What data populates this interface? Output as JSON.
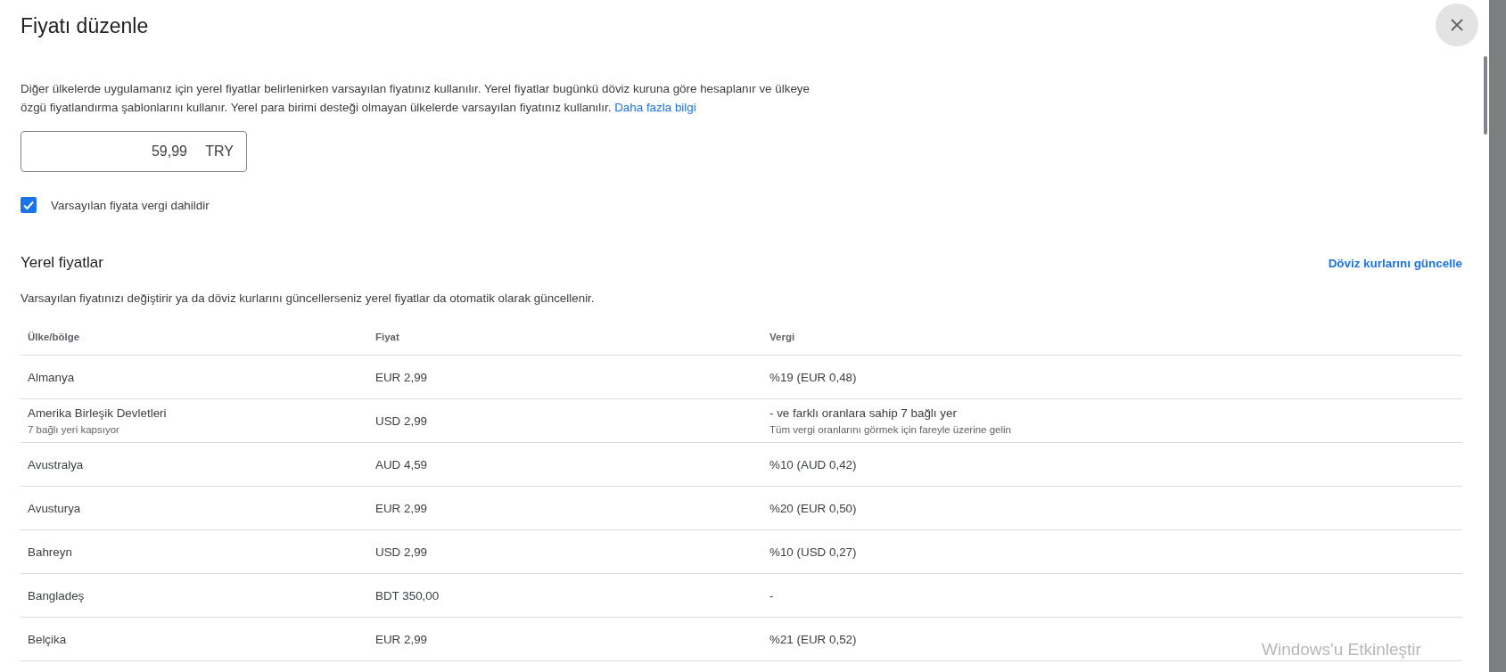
{
  "dialog": {
    "title": "Fiyatı düzenle",
    "description": "Diğer ülkelerde uygulamanız için yerel fiyatlar belirlenirken varsayılan fiyatınız kullanılır. Yerel fiyatlar bugünkü döviz kuruna göre hesaplanır ve ülkeye özgü fiyatlandırma şablonlarını kullanır. Yerel para birimi desteği olmayan ülkelerde varsayılan fiyatınız kullanılır.",
    "learn_more": "Daha fazla bilgi",
    "price_field": {
      "value": "59,99",
      "currency": "TRY"
    },
    "tax_included": {
      "label": "Varsayılan fiyata vergi dahildir",
      "checked": true
    },
    "local_prices": {
      "title": "Yerel fiyatlar",
      "update_link": "Döviz kurlarını güncelle",
      "subtitle": "Varsayılan fiyatınızı değiştirir ya da döviz kurlarını güncellerseniz yerel fiyatlar da otomatik olarak güncellenir.",
      "table": {
        "columns": [
          "Ülke/bölge",
          "Fiyat",
          "Vergi"
        ],
        "rows": [
          {
            "country": "Almanya",
            "price": "EUR 2,99",
            "tax": "%19 (EUR 0,48)"
          },
          {
            "country": "Amerika Birleşik Devletleri",
            "country_note": "7 bağlı yeri kapsıyor",
            "price": "USD 2,99",
            "tax": "- ve farklı oranlara sahip 7 bağlı yer",
            "tax_note": "Tüm vergi oranlarını görmek için fareyle üzerine gelin"
          },
          {
            "country": "Avustralya",
            "price": "AUD 4,59",
            "tax": "%10 (AUD 0,42)"
          },
          {
            "country": "Avusturya",
            "price": "EUR 2,99",
            "tax": "%20 (EUR 0,50)"
          },
          {
            "country": "Bahreyn",
            "price": "USD 2,99",
            "tax": "%10 (USD 0,27)"
          },
          {
            "country": "Bangladeş",
            "price": "BDT 350,00",
            "tax": "-"
          },
          {
            "country": "Belçika",
            "price": "EUR 2,99",
            "tax": "%21 (EUR 0,52)"
          }
        ]
      }
    }
  },
  "os_overlay": {
    "activation_notice": "Windows'u Etkinleştir"
  }
}
